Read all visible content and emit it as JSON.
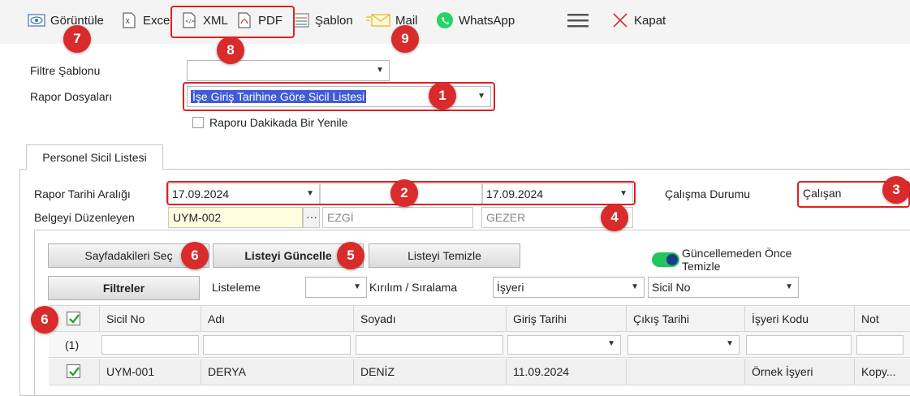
{
  "toolbar": {
    "view": "Görüntüle",
    "excel": "Excel",
    "xml": "XML",
    "pdf": "PDF",
    "template": "Şablon",
    "mail": "Mail",
    "whatsapp": "WhatsApp",
    "close": "Kapat",
    "icons": [
      "eye-icon",
      "excel-icon",
      "xml-icon",
      "pdf-icon",
      "template-icon",
      "mail-icon",
      "whatsapp-icon",
      "hamburger-menu-icon",
      "close-icon"
    ]
  },
  "badges": {
    "b1": "1",
    "b2": "2",
    "b3": "3",
    "b4": "4",
    "b5": "5",
    "b6a": "6",
    "b6b": "6",
    "b7": "7",
    "b8": "8",
    "b9": "9"
  },
  "form": {
    "filter_template_label": "Filtre Şablonu",
    "filter_template_value": "",
    "report_files_label": "Rapor Dosyaları",
    "report_files_value": "İşe Giriş Tarihine Göre Sicil Listesi",
    "refresh_label": "Raporu Dakikada Bir Yenile"
  },
  "tab": {
    "label": "Personel Sicil Listesi"
  },
  "criteria": {
    "date_range_label": "Rapor Tarihi Aralığı",
    "date_from": "17.09.2024",
    "date_to": "17.09.2024",
    "work_status_label": "Çalışma Durumu",
    "work_status_value": "Çalışan",
    "issuer_label": "Belgeyi Düzenleyen",
    "issuer_code": "UYM-002",
    "issuer_ellipsis": "···",
    "issuer_first": "EZGİ",
    "issuer_last": "GEZER"
  },
  "actions": {
    "select_page": "Sayfadakileri Seç",
    "update_list": "Listeyi Güncelle",
    "clear_list": "Listeyi Temizle",
    "toggle_label": "Güncellemeden Önce Temizle",
    "filters": "Filtreler",
    "listing_label": "Listeleme",
    "listing_value": "",
    "grouping_label": "Kırılım / Sıralama",
    "grouping_value1": "İşyeri",
    "grouping_value2": "Sicil No"
  },
  "grid": {
    "columns": [
      "Sicil No",
      "Adı",
      "Soyadı",
      "Giriş Tarihi",
      "Çıkış Tarihi",
      "İşyeri Kodu",
      "Not"
    ],
    "filter_count": "(1)",
    "rows": [
      {
        "sicil": "UYM-001",
        "adi": "DERYA",
        "soyadi": "DENİZ",
        "giris": "11.09.2024",
        "cikis": "",
        "isyeri": "Örnek İşyeri",
        "not": "Kopy..."
      }
    ]
  },
  "colors": {
    "badge": "#d92b2b",
    "highlight": "#3f5bd6",
    "toggle": "#22c55e",
    "checkmark": "#2e9e2e"
  }
}
